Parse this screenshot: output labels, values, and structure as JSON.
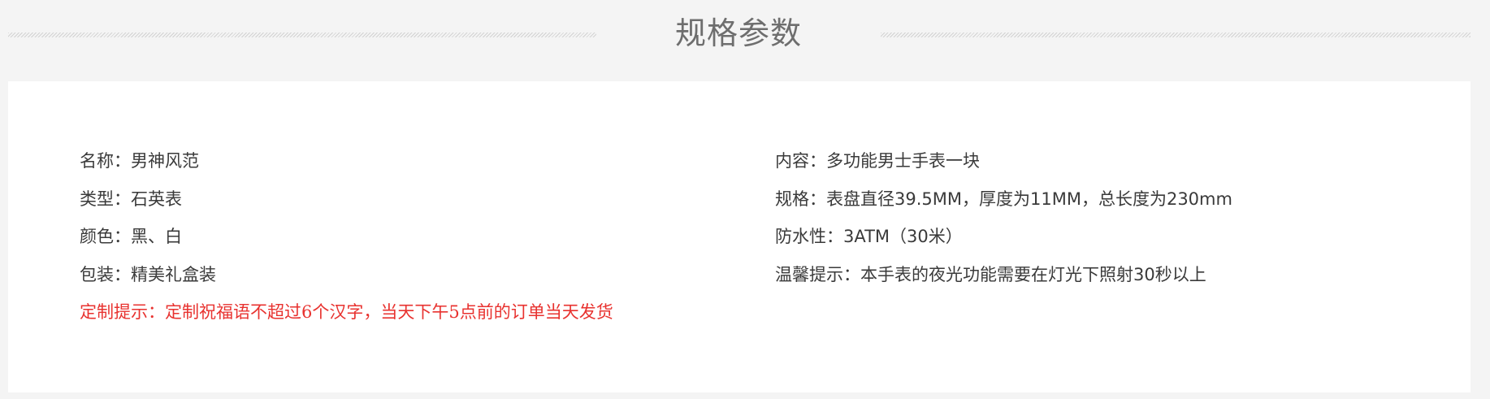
{
  "header": {
    "title": "规格参数"
  },
  "specs": {
    "left": [
      "名称：男神风范",
      "类型：石英表",
      "颜色：黑、白",
      "包装：精美礼盒装"
    ],
    "notice": "定制提示：定制祝福语不超过6个汉字，当天下午5点前的订单当天发货",
    "right": [
      "内容：多功能男士手表一块",
      "规格：表盘直径39.5MM，厚度为11MM，总长度为230mm",
      "防水性：3ATM（30米）",
      "温馨提示：本手表的夜光功能需要在灯光下照射30秒以上"
    ]
  },
  "colors": {
    "page_background": "#f4f4f4",
    "panel_background": "#ffffff",
    "title_text": "#6e6e6e",
    "body_text": "#3a3a3a",
    "notice_text": "#e8322f"
  }
}
